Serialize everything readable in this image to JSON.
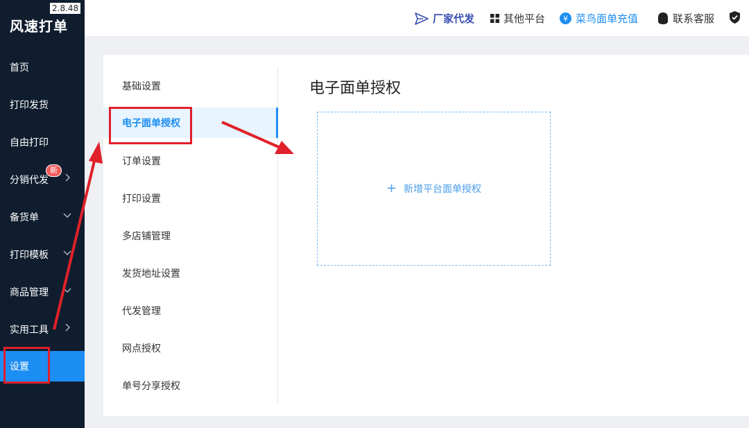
{
  "app": {
    "name": "风速打单",
    "version": "2.8.48"
  },
  "sidebar": {
    "items": [
      {
        "label": "首页"
      },
      {
        "label": "打印发货"
      },
      {
        "label": "自由打印"
      },
      {
        "label": "分销代发",
        "badge": "新",
        "arrow": "chevron-right-icon"
      },
      {
        "label": "备货单",
        "arrow": "chevron-down-icon"
      },
      {
        "label": "打印模板",
        "arrow": "chevron-down-icon"
      },
      {
        "label": "商品管理",
        "arrow": "chevron-down-icon"
      },
      {
        "label": "实用工具",
        "arrow": "chevron-right-icon"
      },
      {
        "label": "设置",
        "active": true
      }
    ]
  },
  "topbar": {
    "links": [
      {
        "label": "厂家代发",
        "icon": "send-icon",
        "color": "#3a4fb3"
      },
      {
        "label": "其他平台",
        "icon": "grid-icon",
        "color": "#333333"
      },
      {
        "label": "菜鸟面单充值",
        "icon": "yen-icon",
        "color": "#1c8df2"
      },
      {
        "label": "联系客服",
        "icon": "headset-icon",
        "color": "#333333"
      },
      {
        "label": "",
        "icon": "shield-icon",
        "color": "#333333"
      }
    ]
  },
  "submenu": {
    "items": [
      {
        "label": "基础设置"
      },
      {
        "label": "电子面单授权",
        "active": true
      },
      {
        "label": "订单设置"
      },
      {
        "label": "打印设置"
      },
      {
        "label": "多店铺管理"
      },
      {
        "label": "发货地址设置"
      },
      {
        "label": "代发管理"
      },
      {
        "label": "网点授权"
      },
      {
        "label": "单号分享授权"
      }
    ]
  },
  "content": {
    "title": "电子面单授权",
    "add_label": "新增平台面单授权"
  },
  "colors": {
    "sidebar_bg": "#0f1d2e",
    "accent": "#1c8df2",
    "annotation": "#e0202a"
  }
}
